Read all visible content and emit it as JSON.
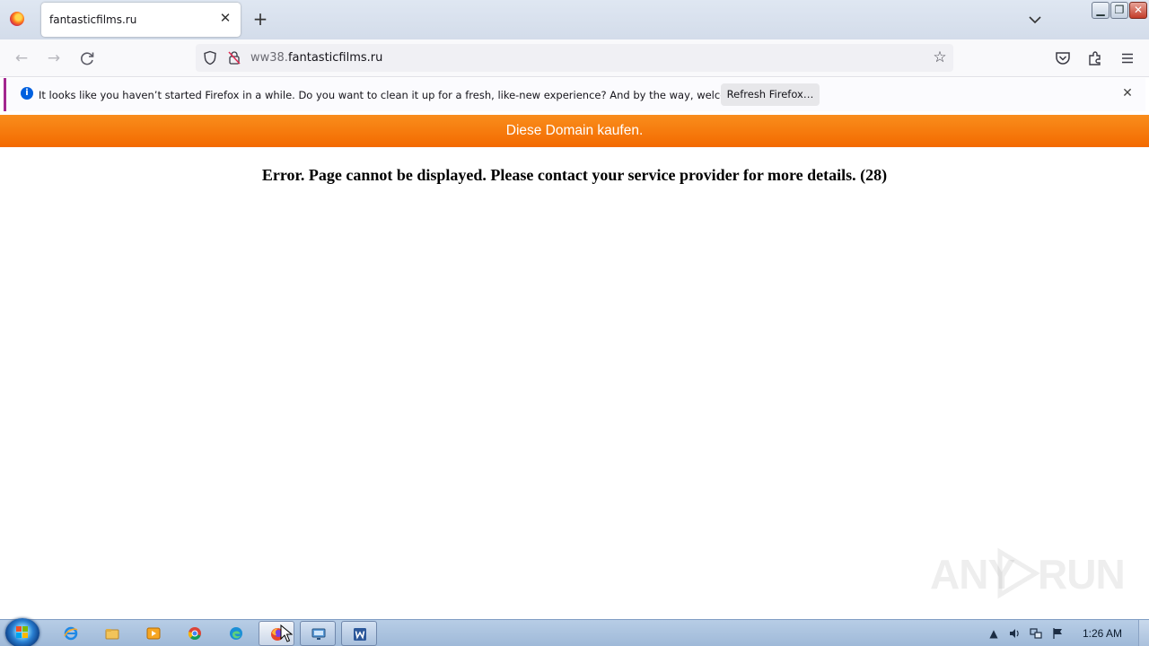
{
  "browser": {
    "tab_title": "fantasticfilms.ru",
    "url_subdomain": "ww38.",
    "url_domain": "fantasticfilms.ru"
  },
  "notification": {
    "message": "It looks like you haven’t started Firefox in a while. Do you want to clean it up for a fresh, like-new experience? And by the way, welcome back!",
    "button_label": "Refresh Firefox…"
  },
  "page": {
    "buy_domain_label": "Diese Domain kaufen.",
    "error_message": "Error. Page cannot be displayed. Please contact your service provider for more details. (28)"
  },
  "watermark": {
    "left": "ANY",
    "right": "RUN"
  },
  "taskbar": {
    "clock": "1:26 AM"
  },
  "colors": {
    "buy_bar": "#f36a00",
    "notice_accent": "#a3278f",
    "info_blue": "#0060df"
  }
}
